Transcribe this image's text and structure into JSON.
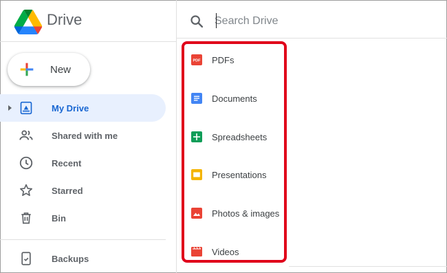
{
  "app": {
    "title": "Drive"
  },
  "sidebar": {
    "new_label": "New",
    "items": [
      {
        "label": "My Drive",
        "icon": "my-drive-icon",
        "active": true
      },
      {
        "label": "Shared with me",
        "icon": "shared-icon",
        "active": false
      },
      {
        "label": "Recent",
        "icon": "clock-icon",
        "active": false
      },
      {
        "label": "Starred",
        "icon": "star-icon",
        "active": false
      },
      {
        "label": "Bin",
        "icon": "trash-icon",
        "active": false
      }
    ],
    "backups": {
      "label": "Backups",
      "icon": "backups-icon"
    }
  },
  "search": {
    "placeholder": "Search Drive"
  },
  "dropdown": {
    "highlight_color": "#e0001a",
    "items": [
      {
        "label": "PDFs",
        "icon": "pdf-icon",
        "color": "#ea4335"
      },
      {
        "label": "Documents",
        "icon": "document-icon",
        "color": "#4285f4"
      },
      {
        "label": "Spreadsheets",
        "icon": "spreadsheet-icon",
        "color": "#0f9d58"
      },
      {
        "label": "Presentations",
        "icon": "presentation-icon",
        "color": "#f4b400"
      },
      {
        "label": "Photos & images",
        "icon": "image-icon",
        "color": "#ea4335"
      },
      {
        "label": "Videos",
        "icon": "video-icon",
        "color": "#ea4335"
      }
    ]
  }
}
